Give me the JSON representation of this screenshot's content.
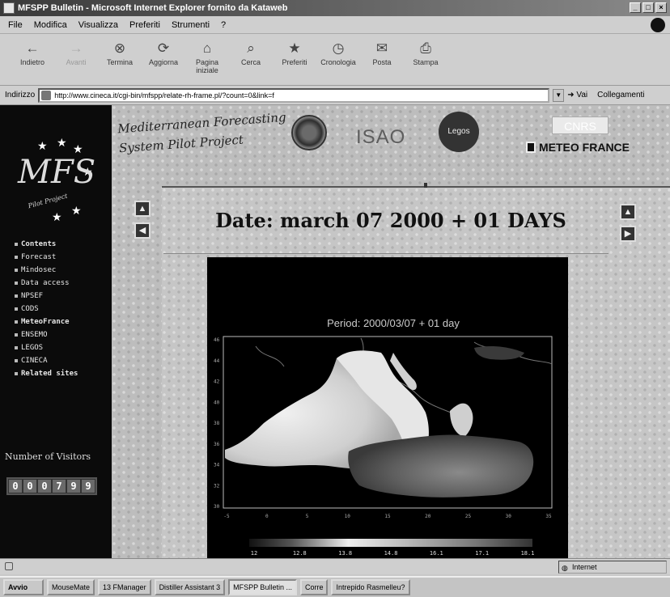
{
  "window": {
    "title": "MFSPP Bulletin - Microsoft Internet Explorer fornito da Kataweb"
  },
  "menu": [
    "File",
    "Modifica",
    "Visualizza",
    "Preferiti",
    "Strumenti",
    "?"
  ],
  "toolbar": [
    {
      "label": "Indietro",
      "icon": "back-arrow-icon",
      "glyph": "←",
      "enabled": true
    },
    {
      "label": "Avanti",
      "icon": "forward-arrow-icon",
      "glyph": "→",
      "enabled": false
    },
    {
      "label": "Termina",
      "icon": "stop-icon",
      "glyph": "⊗",
      "enabled": true
    },
    {
      "label": "Aggiorna",
      "icon": "refresh-icon",
      "glyph": "⟳",
      "enabled": true
    },
    {
      "label": "Pagina iniziale",
      "icon": "home-icon",
      "glyph": "⌂",
      "enabled": true
    },
    {
      "label": "Cerca",
      "icon": "search-icon",
      "glyph": "⌕",
      "enabled": true
    },
    {
      "label": "Preferiti",
      "icon": "favorites-icon",
      "glyph": "★",
      "enabled": true
    },
    {
      "label": "Cronologia",
      "icon": "history-icon",
      "glyph": "◷",
      "enabled": true
    },
    {
      "label": "Posta",
      "icon": "mail-icon",
      "glyph": "✉",
      "enabled": true
    },
    {
      "label": "Stampa",
      "icon": "print-icon",
      "glyph": "⎙",
      "enabled": true
    }
  ],
  "address": {
    "label": "Indirizzo",
    "url": "http://www.cineca.it/cgi-bin/mfspp/relate-rh-frame.pl/?count=0&link=f",
    "go_label": "Vai",
    "links_label": "Collegamenti"
  },
  "sidebar": {
    "logo_text": "MFS",
    "logo_subtitle": "Pilot Project",
    "nav": [
      {
        "label": "Contents",
        "bold": true
      },
      {
        "label": "Forecast",
        "bold": false
      },
      {
        "label": "Mindosec",
        "bold": false
      },
      {
        "label": "Data access",
        "bold": false
      },
      {
        "label": "NPSEF",
        "bold": false
      },
      {
        "label": "CODS",
        "bold": false
      },
      {
        "label": "MeteoFrance",
        "bold": true
      },
      {
        "label": "ENSEMO",
        "bold": false
      },
      {
        "label": "LEGOS",
        "bold": false
      },
      {
        "label": "CINECA",
        "bold": false
      },
      {
        "label": "Related sites",
        "bold": true
      }
    ],
    "visitors_label": "Number of Visitors",
    "visitor_count": "000799"
  },
  "header": {
    "project_line1": "Mediterranean Forecasting",
    "project_line2": "System Pilot Project",
    "isao": "ISAO",
    "legos": "Legos",
    "cnrs": "CNRS",
    "meteo_france": "METEO FRANCE"
  },
  "page": {
    "date_title": "Date: march 07 2000 + 01 DAYS"
  },
  "chart_data": {
    "type": "heatmap",
    "title": "Period: 2000/03/07 + 01 day",
    "xlabel": "",
    "ylabel": "",
    "x_ticks": [
      "-5",
      "0",
      "5",
      "10",
      "15",
      "20",
      "25",
      "30",
      "35"
    ],
    "y_ticks": [
      "46",
      "44",
      "42",
      "40",
      "38",
      "36",
      "34",
      "32",
      "30"
    ],
    "colorbar_ticks": [
      "12",
      "12.8",
      "13.8",
      "14.8",
      "16.1",
      "17.1",
      "18.1"
    ],
    "colorbar_range": [
      12,
      18.1
    ],
    "region": "Mediterranean Sea"
  },
  "status": {
    "zone": "Internet"
  },
  "taskbar": [
    {
      "label": "Avvio",
      "active": false
    },
    {
      "label": "MouseMate",
      "active": false
    },
    {
      "label": "13 FManager",
      "active": false
    },
    {
      "label": "Distiller Assistant 3",
      "active": false
    },
    {
      "label": "MFSPP Bulletin ...",
      "active": true
    },
    {
      "label": "Corre",
      "active": false
    },
    {
      "label": "Intrepido Rasmelleu?",
      "active": false
    }
  ]
}
